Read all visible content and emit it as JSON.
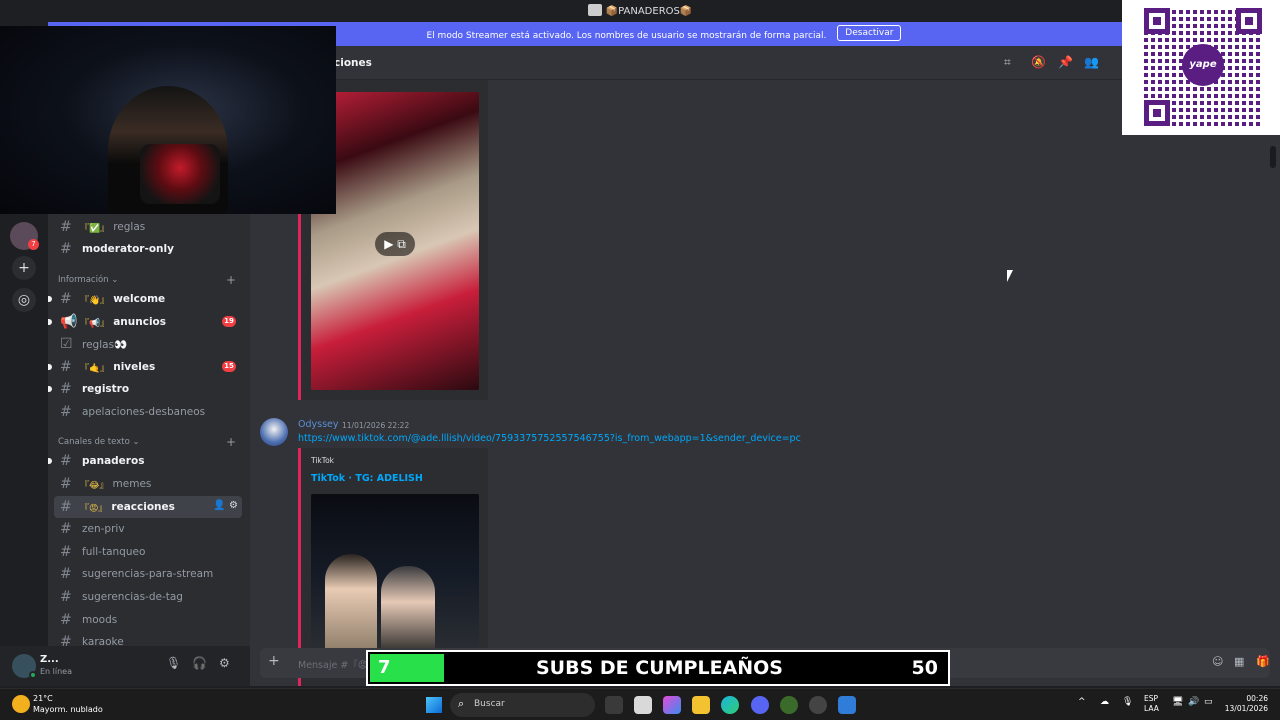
{
  "window": {
    "title": "📦PANADEROS📦"
  },
  "streamer_banner": {
    "text": "El modo Streamer está activado. Los nombres de usuario se mostrarán de forma parcial.",
    "button": "Desactivar"
  },
  "rail": {
    "badge": "7"
  },
  "channels": {
    "top": [
      {
        "emoji": "『✅』",
        "name": "reglas"
      },
      {
        "name": "moderator-only"
      }
    ],
    "categories": {
      "info": "Información",
      "text": "Canales de texto"
    },
    "info_list": [
      {
        "emoji": "『👋』",
        "name": "welcome"
      },
      {
        "emoji": "『📢』",
        "name": "anuncios",
        "badge": "19"
      },
      {
        "name": "reglas👀"
      },
      {
        "emoji": "『🤙』",
        "name": "niveles",
        "badge": "15"
      },
      {
        "name": "registro"
      },
      {
        "name": "apelaciones-desbaneos"
      }
    ],
    "text_list": [
      {
        "name": "panaderos"
      },
      {
        "emoji": "『😂』",
        "name": "memes"
      },
      {
        "emoji": "『😡』",
        "name": "reacciones"
      },
      {
        "name": "zen-priv"
      },
      {
        "name": "full-tanqueo"
      },
      {
        "name": "sugerencias-para-stream"
      },
      {
        "name": "sugerencias-de-tag"
      },
      {
        "name": "moods"
      },
      {
        "name": "karaoke"
      }
    ]
  },
  "user": {
    "name": "Z...",
    "status": "En línea"
  },
  "chat": {
    "header": "ciones",
    "message": {
      "author": "Odyssey",
      "time": "11/01/2026 22:22",
      "link": "https://www.tiktok.com/@ade.lllish/video/7593375752557546755?is_from_webapp=1&sender_device=pc",
      "embed_provider": "TikTok",
      "embed_title": "TikTok · TG: ADELISH"
    },
    "composer_placeholder": "Mensaje #『😡』"
  },
  "qr": {
    "brand": "yape"
  },
  "subs_bar": {
    "count": "7",
    "label": "SUBS DE CUMPLEAÑOS",
    "goal": "50",
    "color": "#28e04a"
  },
  "taskbar": {
    "temp": "21°C",
    "weather": "Mayorm. nublado",
    "search": "Buscar",
    "lang_line1": "ESP",
    "lang_line2": "LAA",
    "time": "00:26",
    "date": "13/01/2026"
  },
  "colors": {
    "accent": "#5865f2",
    "link": "#00a8fc",
    "embed_border": "#e0245e",
    "danger": "#f23f43"
  }
}
